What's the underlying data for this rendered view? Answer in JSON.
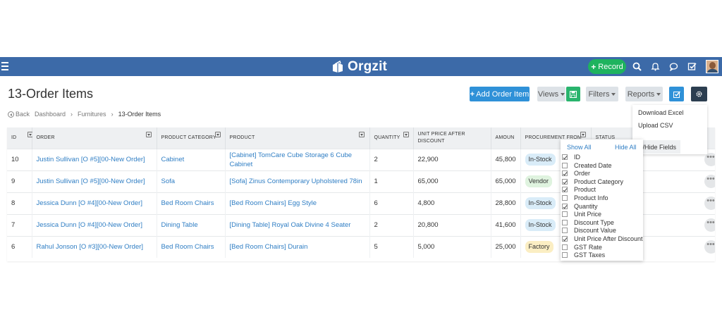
{
  "app": {
    "brand": "Orgzit"
  },
  "topbar": {
    "record_label": "Record"
  },
  "page": {
    "title": "13-Order Items"
  },
  "toolbar": {
    "add_label": "Add Order Item",
    "views_label": "Views",
    "filters_label": "Filters",
    "reports_label": "Reports"
  },
  "breadcrumb": {
    "back": "Back",
    "items": [
      "Dashboard",
      "Furnitures",
      "13-Order Items"
    ]
  },
  "reports_menu": {
    "items": [
      "Download Excel",
      "Upload CSV"
    ]
  },
  "show_hide_label": "how/Hide Fields",
  "table": {
    "headers": [
      "ID",
      "ORDER",
      "PRODUCT CATEGORY",
      "PRODUCT",
      "QUANTITY",
      "UNIT PRICE AFTER DISCOUNT",
      "AMOUN",
      "PROCUREMENT FROM",
      "STATUS"
    ],
    "rows": [
      {
        "id": "10",
        "order": "Justin Sullivan [O #5][00-New Order]",
        "category": "Cabinet",
        "product": "[Cabinet] TomCare Cube Storage 6 Cube Cabinet",
        "qty": "2",
        "unit_price": "22,900",
        "amount": "45,800",
        "proc": "In-Stock",
        "proc_kind": "instock"
      },
      {
        "id": "9",
        "order": "Justin Sullivan [O #5][00-New Order]",
        "category": "Sofa",
        "product": "[Sofa] Zinus Contemporary Upholstered 78in",
        "qty": "1",
        "unit_price": "65,000",
        "amount": "65,000",
        "proc": "Vendor",
        "proc_kind": "vendor"
      },
      {
        "id": "8",
        "order": "Jessica Dunn [O #4][00-New Order]",
        "category": "Bed Room Chairs",
        "product": "[Bed Room Chairs] Egg Style",
        "qty": "6",
        "unit_price": "4,800",
        "amount": "28,800",
        "proc": "In-Stock",
        "proc_kind": "instock"
      },
      {
        "id": "7",
        "order": "Jessica Dunn [O #4][00-New Order]",
        "category": "Dining Table",
        "product": "[Dining Table] Royal Oak Divine 4 Seater",
        "qty": "2",
        "unit_price": "20,800",
        "amount": "41,600",
        "proc": "In-Stock",
        "proc_kind": "instock"
      },
      {
        "id": "6",
        "order": "Rahul Jonson [O #3][00-New Order]",
        "category": "Bed Room Chairs",
        "product": "[Bed Room Chairs] Durain",
        "qty": "5",
        "unit_price": "5,000",
        "amount": "25,000",
        "proc": "Factory",
        "proc_kind": "factory"
      }
    ]
  },
  "fields_panel": {
    "show_all": "Show All",
    "hide_all": "Hide All",
    "fields": [
      {
        "label": "ID",
        "checked": true
      },
      {
        "label": "Created Date",
        "checked": false
      },
      {
        "label": "Order",
        "checked": true
      },
      {
        "label": "Product Category",
        "checked": true
      },
      {
        "label": "Product",
        "checked": true
      },
      {
        "label": "Product Info",
        "checked": false
      },
      {
        "label": "Quantity",
        "checked": true
      },
      {
        "label": "Unit Price",
        "checked": false
      },
      {
        "label": "Discount Type",
        "checked": false
      },
      {
        "label": "Discount Value",
        "checked": false
      },
      {
        "label": "Unit Price After Discount",
        "checked": true
      },
      {
        "label": "GST Rate",
        "checked": false
      },
      {
        "label": "GST Taxes",
        "checked": false
      }
    ]
  },
  "colors": {
    "topbar": "#3c6aa8",
    "record": "#1eb35e",
    "primary": "#2f91d8",
    "link": "#2f7ec4",
    "instock_bg": "#d9ecf8",
    "vendor_bg": "#dff3df",
    "factory_bg": "#fbeec3"
  }
}
